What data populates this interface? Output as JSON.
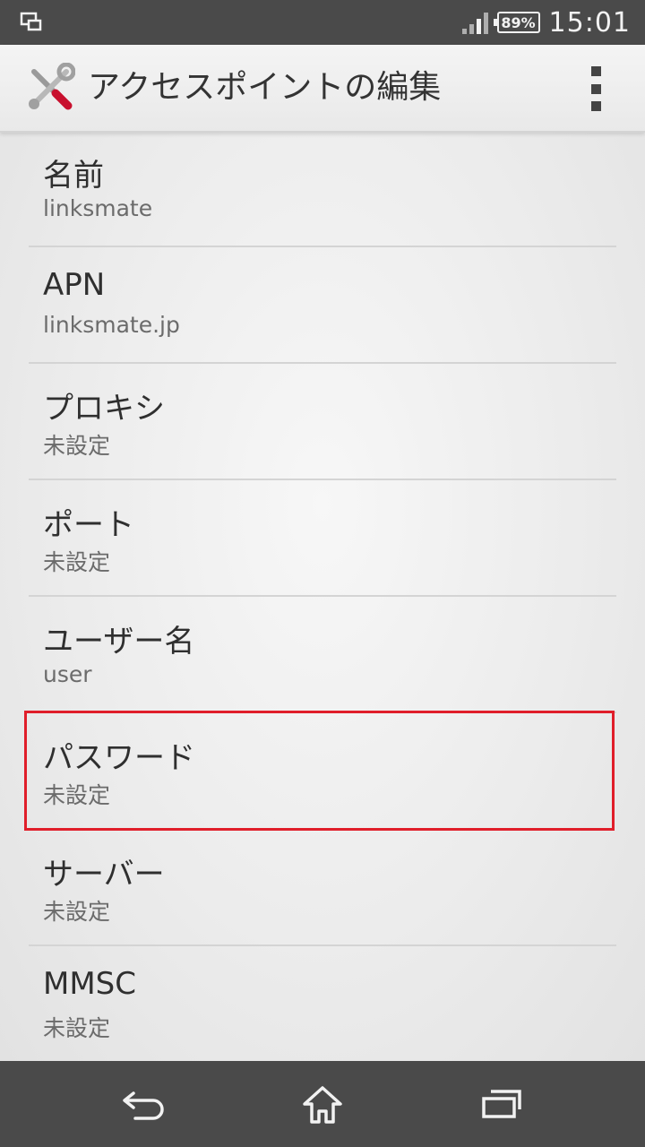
{
  "status_bar": {
    "battery": "89%",
    "time": "15:01",
    "icons": [
      "screen-mirror-icon",
      "signal-icon",
      "battery-icon"
    ]
  },
  "action_bar": {
    "title": "アクセスポイントの編集",
    "icons": [
      "settings-tools-icon",
      "overflow-menu-icon"
    ]
  },
  "settings": [
    {
      "label": "名前",
      "value": "linksmate"
    },
    {
      "label": "APN",
      "value": "linksmate.jp"
    },
    {
      "label": "プロキシ",
      "value": "未設定"
    },
    {
      "label": "ポート",
      "value": "未設定"
    },
    {
      "label": "ユーザー名",
      "value": "user"
    },
    {
      "label": "パスワード",
      "value": "未設定"
    },
    {
      "label": "サーバー",
      "value": "未設定"
    },
    {
      "label": "MMSC",
      "value": "未設定"
    }
  ],
  "highlight_color": "#e01e2a",
  "nav_bar": {
    "icons": [
      "back-icon",
      "home-icon",
      "recent-apps-icon"
    ]
  }
}
